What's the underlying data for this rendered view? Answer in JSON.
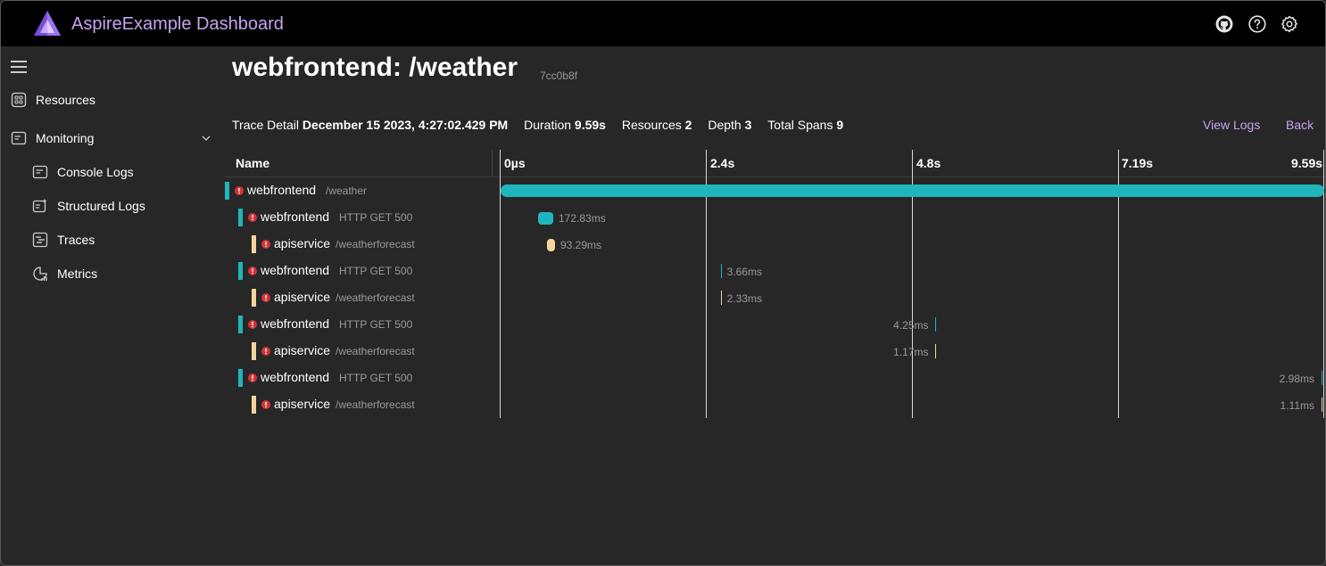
{
  "header": {
    "app_title": "AspireExample Dashboard",
    "icons": [
      "github-icon",
      "help-icon",
      "settings-icon"
    ]
  },
  "sidebar": {
    "items": [
      {
        "label": "Resources",
        "icon": "resources-icon"
      },
      {
        "label": "Monitoring",
        "icon": "monitoring-icon",
        "expanded": true
      },
      {
        "label": "Console Logs",
        "icon": "console-logs-icon"
      },
      {
        "label": "Structured Logs",
        "icon": "structured-logs-icon"
      },
      {
        "label": "Traces",
        "icon": "traces-icon"
      },
      {
        "label": "Metrics",
        "icon": "metrics-icon"
      }
    ]
  },
  "page": {
    "title": "webfrontend: /weather",
    "trace_id": "7cc0b8f",
    "summary": {
      "trace_detail_label": "Trace Detail",
      "trace_detail_value": "December 15 2023, 4:27:02.429 PM",
      "duration_label": "Duration",
      "duration_value": "9.59s",
      "resources_label": "Resources",
      "resources_value": "2",
      "depth_label": "Depth",
      "depth_value": "3",
      "total_spans_label": "Total Spans",
      "total_spans_value": "9"
    },
    "actions": {
      "view_logs": "View Logs",
      "back": "Back"
    }
  },
  "grid": {
    "name_header": "Name",
    "ticks": [
      "0µs",
      "2.4s",
      "4.8s",
      "7.19s",
      "9.59s"
    ],
    "colors": {
      "webfrontend": "#1fb5bc",
      "apiservice": "#f5d59b",
      "error": "#d13438"
    },
    "spans": [
      {
        "service": "webfrontend",
        "detail": "/weather",
        "depth": 0,
        "duration": "",
        "start_s": 0,
        "duration_s": 9.59
      },
      {
        "service": "webfrontend",
        "detail": "HTTP GET 500",
        "depth": 1,
        "duration": "172.83ms",
        "start_s": 0.45,
        "duration_s": 0.17283
      },
      {
        "service": "apiservice",
        "detail": "/weatherforecast",
        "depth": 2,
        "duration": "93.29ms",
        "start_s": 0.55,
        "duration_s": 0.09329
      },
      {
        "service": "webfrontend",
        "detail": "HTTP GET 500",
        "depth": 1,
        "duration": "3.66ms",
        "start_s": 2.57,
        "duration_s": 0.00366
      },
      {
        "service": "apiservice",
        "detail": "/weatherforecast",
        "depth": 2,
        "duration": "2.33ms",
        "start_s": 2.57,
        "duration_s": 0.00233
      },
      {
        "service": "webfrontend",
        "detail": "HTTP GET 500",
        "depth": 1,
        "duration": "4.25ms",
        "start_s": 5.07,
        "duration_s": 0.00425
      },
      {
        "service": "apiservice",
        "detail": "/weatherforecast",
        "depth": 2,
        "duration": "1.17ms",
        "start_s": 5.07,
        "duration_s": 0.00117
      },
      {
        "service": "webfrontend",
        "detail": "HTTP GET 500",
        "depth": 1,
        "duration": "2.98ms",
        "start_s": 9.58,
        "duration_s": 0.00298
      },
      {
        "service": "apiservice",
        "detail": "/weatherforecast",
        "depth": 2,
        "duration": "1.11ms",
        "start_s": 9.58,
        "duration_s": 0.00111
      }
    ]
  }
}
